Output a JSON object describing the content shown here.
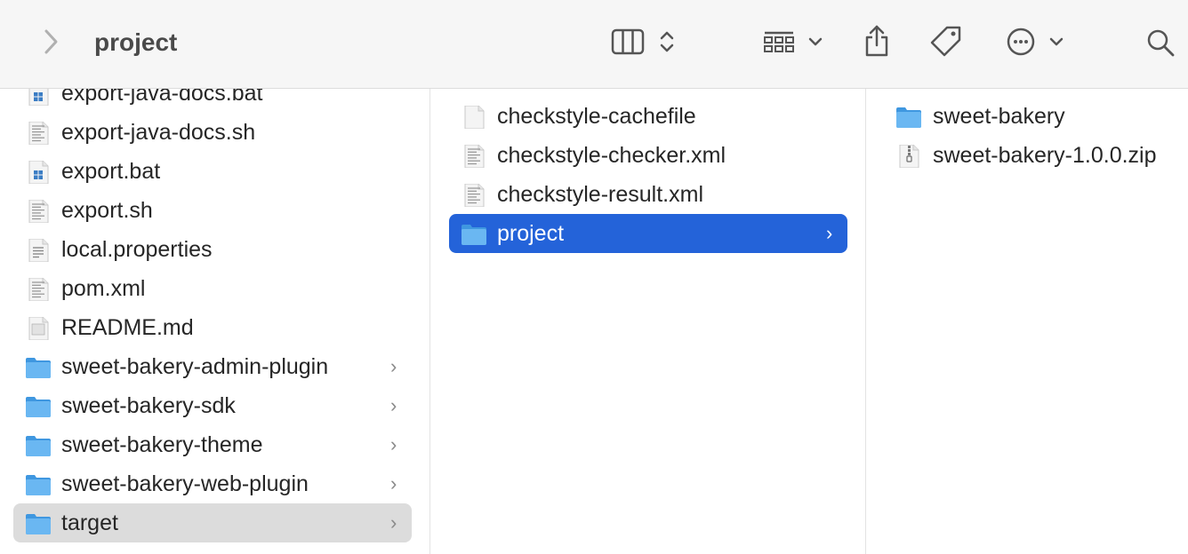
{
  "toolbar": {
    "title": "project",
    "icons": [
      "back-chevron-icon",
      "column-view-icon",
      "view-sort-arrows-icon",
      "group-grid-icon",
      "dropdown-chevron-icon",
      "share-icon",
      "tag-icon",
      "more-actions-icon",
      "more-chevron-icon",
      "search-icon"
    ]
  },
  "column1": {
    "items": [
      {
        "label": "export-java-docs.bat",
        "icon": "windows-file-icon"
      },
      {
        "label": "export-java-docs.sh",
        "icon": "script-file-icon"
      },
      {
        "label": "export.bat",
        "icon": "windows-file-icon"
      },
      {
        "label": "export.sh",
        "icon": "script-file-icon"
      },
      {
        "label": "local.properties",
        "icon": "text-file-icon"
      },
      {
        "label": "pom.xml",
        "icon": "script-file-icon"
      },
      {
        "label": "README.md",
        "icon": "markdown-file-icon"
      },
      {
        "label": "sweet-bakery-admin-plugin",
        "icon": "folder-icon"
      },
      {
        "label": "sweet-bakery-sdk",
        "icon": "folder-icon"
      },
      {
        "label": "sweet-bakery-theme",
        "icon": "folder-icon"
      },
      {
        "label": "sweet-bakery-web-plugin",
        "icon": "folder-icon"
      },
      {
        "label": "target",
        "icon": "folder-icon"
      }
    ]
  },
  "column2": {
    "items": [
      {
        "label": "checkstyle-cachefile",
        "icon": "blank-file-icon"
      },
      {
        "label": "checkstyle-checker.xml",
        "icon": "script-file-icon"
      },
      {
        "label": "checkstyle-result.xml",
        "icon": "script-file-icon"
      },
      {
        "label": "project",
        "icon": "folder-icon"
      }
    ]
  },
  "column3": {
    "items": [
      {
        "label": "sweet-bakery",
        "icon": "folder-icon"
      },
      {
        "label": "sweet-bakery-1.0.0.zip",
        "icon": "zip-file-icon"
      }
    ]
  },
  "chevron_glyph": "›",
  "colors": {
    "selection_blue": "#2463d9",
    "selection_gray": "#dcdcdc",
    "folder_blue": "#5aaef0"
  }
}
